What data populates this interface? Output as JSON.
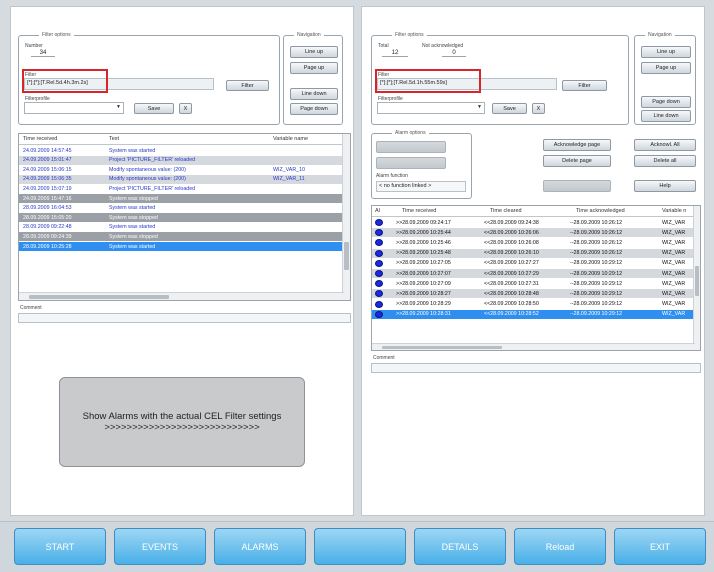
{
  "left": {
    "filter_options": {
      "legend": "Filter options",
      "number_label": "Number",
      "number_value": "34",
      "filter_label": "Filter",
      "filter_value": "[*];[*];[T.Rel.5d.4h.3m.2s]",
      "filter_button": "Filter",
      "filterprofile_label": "Filterprofile",
      "save_button": "Save",
      "x_button": "X"
    },
    "navigation": {
      "legend": "Navigation",
      "line_up": "Line up",
      "page_up": "Page up",
      "line_down": "Line down",
      "page_down": "Page down"
    },
    "table": {
      "headers": [
        "Time received",
        "Text",
        "Variable name"
      ],
      "rows": [
        {
          "time": "24.09.2009 14:57:45",
          "text": "System was started",
          "var": "",
          "style": "w"
        },
        {
          "time": "24.09.2009 15:01:47",
          "text": "Project 'PICTURE_FILTER' reloaded",
          "var": "",
          "style": "g"
        },
        {
          "time": "24.09.2009 15:06:15",
          "text": "Modify spontaneous value: (200)",
          "var": "WIZ_VAR_10",
          "style": "w"
        },
        {
          "time": "24.09.2009 15:06:35",
          "text": "Modify spontaneous value: (200)",
          "var": "WIZ_VAR_11",
          "style": "g"
        },
        {
          "time": "24.09.2009 15:07:19",
          "text": "Project 'PICTURE_FILTER' reloaded",
          "var": "",
          "style": "w"
        },
        {
          "time": "24.09.2009 15:47:16",
          "text": "System was stopped",
          "var": "",
          "style": "d"
        },
        {
          "time": "28.09.2009 16:04:53",
          "text": "System was started",
          "var": "",
          "style": "w"
        },
        {
          "time": "28.09.2009 15:05:20",
          "text": "System was stopped",
          "var": "",
          "style": "d"
        },
        {
          "time": "28.09.2009 09:22:48",
          "text": "System was started",
          "var": "",
          "style": "w"
        },
        {
          "time": "28.09.2009 09:24:39",
          "text": "System was stopped",
          "var": "",
          "style": "d"
        },
        {
          "time": "28.09.2009 10:25:28",
          "text": "System was started",
          "var": "",
          "style": "s"
        }
      ]
    },
    "comment_label": "Comment",
    "show_alarms_line1": "Show Alarms with the actual CEL Filter settings",
    "show_alarms_line2": ">>>>>>>>>>>>>>>>>>>>>>>>>>>>"
  },
  "right": {
    "filter_options": {
      "legend": "Filter options",
      "total_label": "Total",
      "total_value": "12",
      "not_ack_label": "Not acknowledged",
      "not_ack_value": "0",
      "filter_label": "Filter",
      "filter_value": "[*];[*];[T.Rel.5d.1h.55m.59s]",
      "filter_button": "Filter",
      "filterprofile_label": "Filterprofile",
      "save_button": "Save",
      "x_button": "X"
    },
    "navigation": {
      "legend": "Navigation",
      "line_up": "Line up",
      "page_up": "Page up",
      "page_down": "Page down",
      "line_down": "Line down"
    },
    "alarm_options": {
      "legend": "Alarm options",
      "acknowledge_page": "Acknowledge page",
      "acknowl_all": "Acknowl. All",
      "delete_page": "Delete page",
      "delete_all": "Delete all",
      "alarm_function_label": "Alarm function",
      "alarm_function_value": "< no function linked >",
      "help": "Help"
    },
    "table": {
      "headers": [
        "Al",
        "Time received",
        "Time cleared",
        "Time acknowledged",
        "Variable n"
      ],
      "rows": [
        {
          "received": ">>28.09.2009 09:24:17",
          "cleared": "<<28.09.2009 09:24:38",
          "ack": "--28.09.2009 10:26:12",
          "var": "WIZ_VAR",
          "style": "w"
        },
        {
          "received": ">>28.09.2009 10:25:44",
          "cleared": "<<28.09.2009 10:26:06",
          "ack": "--28.09.2009 10:26:12",
          "var": "WIZ_VAR",
          "style": "g"
        },
        {
          "received": ">>28.09.2009 10:25:46",
          "cleared": "<<28.09.2009 10:26:08",
          "ack": "--28.09.2009 10:26:12",
          "var": "WIZ_VAR",
          "style": "w"
        },
        {
          "received": ">>28.09.2009 10:25:48",
          "cleared": "<<28.09.2009 10:26:10",
          "ack": "--28.09.2009 10:26:12",
          "var": "WIZ_VAR",
          "style": "g"
        },
        {
          "received": ">>28.09.2009 10:27:05",
          "cleared": "<<28.09.2009 10:27:27",
          "ack": "--28.09.2009 10:29:12",
          "var": "WIZ_VAR",
          "style": "w"
        },
        {
          "received": ">>28.09.2009 10:27:07",
          "cleared": "<<28.09.2009 10:27:29",
          "ack": "--28.09.2009 10:29:12",
          "var": "WIZ_VAR",
          "style": "g"
        },
        {
          "received": ">>28.09.2009 10:27:09",
          "cleared": "<<28.09.2009 10:27:31",
          "ack": "--28.09.2009 10:29:12",
          "var": "WIZ_VAR",
          "style": "w"
        },
        {
          "received": ">>28.09.2009 10:28:27",
          "cleared": "<<28.09.2009 10:28:48",
          "ack": "--28.09.2009 10:29:12",
          "var": "WIZ_VAR",
          "style": "g"
        },
        {
          "received": ">>28.09.2009 10:28:29",
          "cleared": "<<28.09.2009 10:28:50",
          "ack": "--28.09.2009 10:29:12",
          "var": "WIZ_VAR",
          "style": "w"
        },
        {
          "received": ">>28.09.2009 10:28:31",
          "cleared": "<<28.09.2009 10:28:52",
          "ack": "--28.09.2009 10:29:12",
          "var": "WIZ_VAR",
          "style": "s"
        }
      ]
    },
    "comment_label": "Comment"
  },
  "taskbar": {
    "start": "START",
    "events": "EVENTS",
    "alarms": "ALARMS",
    "empty": "",
    "details": "DETAILS",
    "reload": "Reload",
    "exit": "EXIT"
  },
  "colors": {
    "row_text_blue": "#2638c8",
    "row_gray": "#d5d8dc",
    "row_dark": "#9aa0a6",
    "row_selected": "#2f8ff0",
    "highlight_red": "#d8252b",
    "alarm_dot": "#1a2ae0",
    "taskbar_button": "#48b0e8"
  }
}
